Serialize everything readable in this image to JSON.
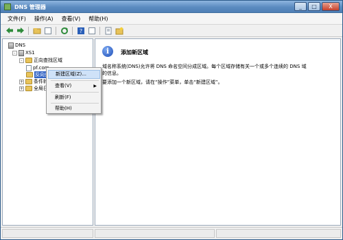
{
  "window": {
    "title": "DNS 管理器",
    "controls": [
      "_",
      "□",
      "X"
    ]
  },
  "menu": [
    "文件(F)",
    "操作(A)",
    "查看(V)",
    "帮助(H)"
  ],
  "toolbar": [
    "back-arrow-icon",
    "forward-arrow-icon",
    "up-folder-icon",
    "show-tree-icon",
    "refresh-icon",
    "help-icon",
    "properties-icon",
    "console-icon",
    "new-zone-icon"
  ],
  "tree": {
    "root": "DNS",
    "server": "XS1",
    "forward_zone": "正向查找区域",
    "zone_item": "pf.com",
    "reverse_zone": "反向查找区域",
    "conditional": "条件转发器",
    "global": "全局日志"
  },
  "content": {
    "title": "添加新区域",
    "para1a": "域名称系统(DNS)允许将 DNS 命名空间分成区域。每个区域存储有关一个或多个连续的 DNS 域",
    "para1b": "的信息。",
    "para2": "要添加一个新区域，请在“操作”菜单，单击“新建区域”。"
  },
  "context_menu": {
    "new_zone": "新建区域(Z)...",
    "view": "查看(V)",
    "refresh": "刷新(F)",
    "help": "帮助(H)"
  }
}
